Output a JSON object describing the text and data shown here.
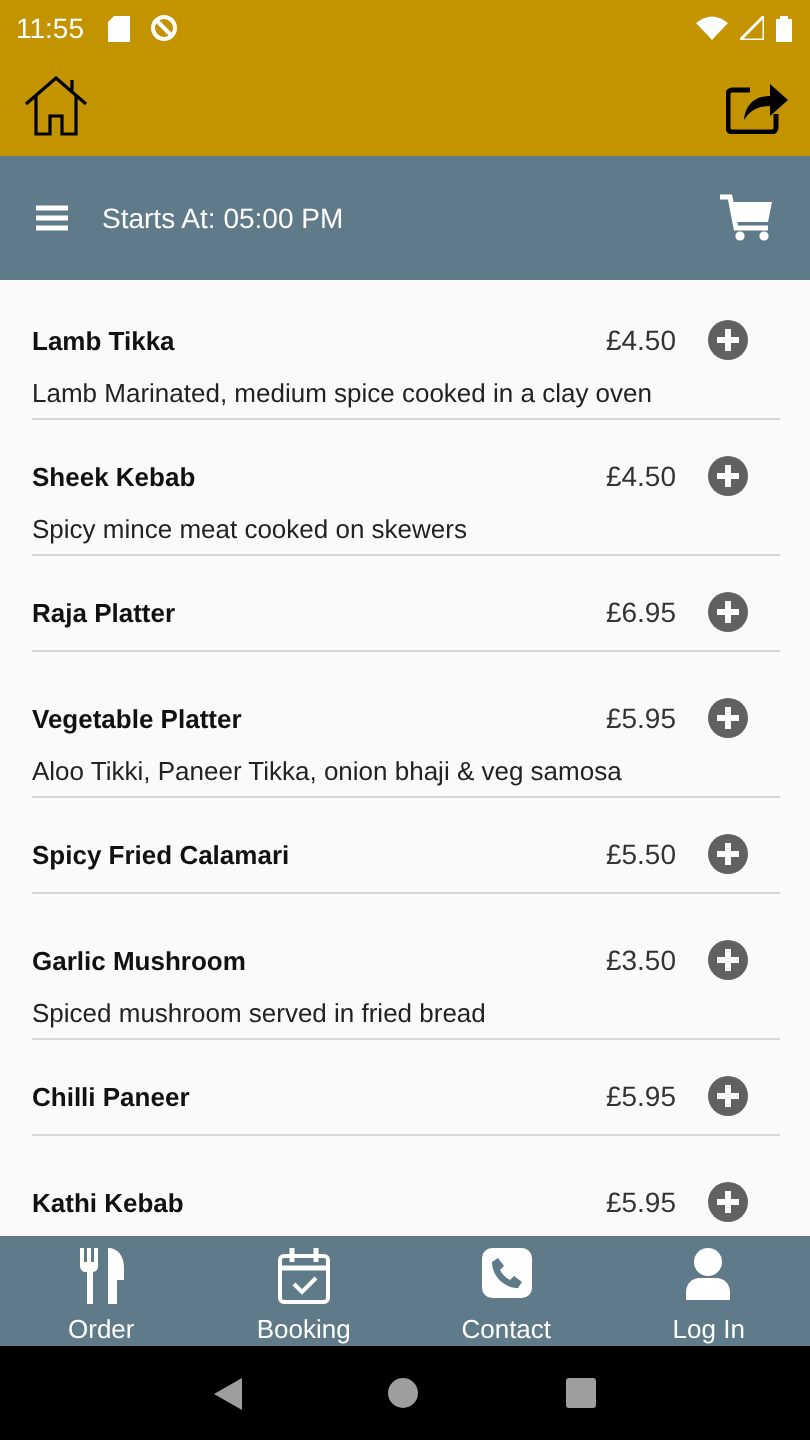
{
  "status_bar": {
    "time": "11:55"
  },
  "subheader": {
    "title": "Starts At: 05:00 PM"
  },
  "menu_items": [
    {
      "name": "Lamb Tikka",
      "price": "£4.50",
      "description": "Lamb Marinated, medium spice cooked in a clay oven"
    },
    {
      "name": "Sheek Kebab",
      "price": "£4.50",
      "description": "Spicy mince meat cooked on skewers"
    },
    {
      "name": "Raja Platter",
      "price": "£6.95"
    },
    {
      "name": "Vegetable Platter",
      "price": "£5.95",
      "description": "Aloo Tikki, Paneer Tikka, onion bhaji & veg samosa"
    },
    {
      "name": "Spicy Fried Calamari",
      "price": "£5.50"
    },
    {
      "name": "Garlic Mushroom",
      "price": "£3.50",
      "description": "Spiced mushroom served in fried bread"
    },
    {
      "name": "Chilli Paneer",
      "price": "£5.95"
    },
    {
      "name": "Kathi Kebab",
      "price": "£5.95"
    }
  ],
  "bottom_nav": [
    {
      "label": "Order",
      "kind": "order"
    },
    {
      "label": "Booking",
      "kind": "booking"
    },
    {
      "label": "Contact",
      "kind": "contact"
    },
    {
      "label": "Log In",
      "kind": "login"
    }
  ]
}
